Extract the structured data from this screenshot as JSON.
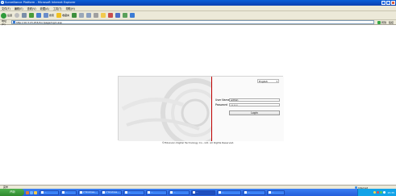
{
  "window": {
    "title": "Surveillance Platform - Microsoft Internet Explorer"
  },
  "menu": [
    "文件(F)",
    "编辑(E)",
    "查看(V)",
    "收藏(A)",
    "工具(T)",
    "帮助(H)"
  ],
  "toolbar": {
    "back": "后退",
    "search": "搜索",
    "favorites": "收藏夹"
  },
  "address": {
    "label": "地址(D)",
    "url": "http://10.3.15.253/doc/page/login.asp",
    "go": "转到",
    "links": "链接"
  },
  "login": {
    "language": "English",
    "username_label": "User Name",
    "username_value": "admin",
    "password_label": "Password",
    "password_value": "•••••",
    "login_button": "Login"
  },
  "footer": {
    "copyright": "©Hikvision Digital Technology Co., Ltd. All Rights Reserved."
  },
  "status": {
    "left": "完毕",
    "zone": "Internet"
  },
  "taskbar": {
    "start": "开始",
    "tasks": [
      "...",
      "...",
      "2 Windows...",
      "2 Windows...",
      "...",
      "...",
      "...",
      "...",
      "...",
      "...",
      "..."
    ],
    "clock": "15:35"
  }
}
